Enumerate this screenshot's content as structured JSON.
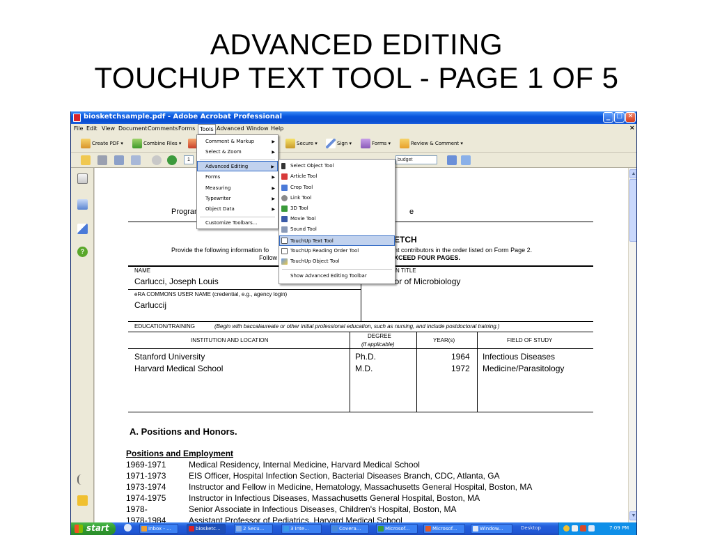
{
  "slide": {
    "title_line1": "ADVANCED EDITING",
    "title_line2": "TOUCHUP TEXT TOOL - PAGE 1 OF 5"
  },
  "window": {
    "title": "biosketchsample.pdf - Adobe Acrobat Professional",
    "minimize_glyph": "_",
    "maximize_glyph": "□",
    "close_glyph": "✕",
    "doc_close_glyph": "×"
  },
  "menubar": [
    "File",
    "Edit",
    "View",
    "Document",
    "Comments",
    "Forms",
    "Tools",
    "Advanced",
    "Window",
    "Help"
  ],
  "toolbar": {
    "create_pdf": "Create PDF ▾",
    "combine_files": "Combine Files ▾",
    "secure": "Secure ▾",
    "sign": "Sign ▾",
    "forms": "Forms ▾",
    "review_comment": "Review & Comment ▾",
    "page_number": "1",
    "zoom_value": "…",
    "zoom_value2": "budget"
  },
  "tools_menu": {
    "items": [
      "Comment & Markup",
      "Select & Zoom",
      "Advanced Editing",
      "Forms",
      "Measuring",
      "Typewriter",
      "Object Data",
      "Customize Toolbars..."
    ]
  },
  "advanced_editing_menu": {
    "items": [
      "Select Object Tool",
      "Article Tool",
      "Crop Tool",
      "Link Tool",
      "3D Tool",
      "Movie Tool",
      "Sound Tool",
      "TouchUp Text Tool",
      "TouchUp Reading Order Tool",
      "TouchUp Object Tool",
      "Show Advanced Editing Toolbar"
    ]
  },
  "document": {
    "program_left": "Program",
    "program_right": "e",
    "biosketch_fragment": "ETCH",
    "instruction_left": "Provide the following information fo",
    "instruction_right": "nt contributors in the order listed on Form Page 2.",
    "follow_left": "Follow th",
    "follow_right": "XCEED FOUR PAGES.",
    "name_label": "NAME",
    "name_value": "Carlucci, Joseph Louis",
    "position_title_label": "N TITLE",
    "position_title_value": "Professor of Microbiology",
    "era_label": "eRA COMMONS USER NAME (credential, e.g., agency login)",
    "era_value": "Carluccij",
    "education_label": "EDUCATION/TRAINING",
    "education_note": "(Begin with baccalaureate or other initial professional education, such as nursing, and include postdoctoral training.)",
    "col_institution": "INSTITUTION AND LOCATION",
    "col_degree": "DEGREE",
    "col_degree_note": "(if applicable)",
    "col_years": "YEAR(s)",
    "col_field": "FIELD OF STUDY",
    "education_rows": [
      {
        "institution": "Stanford University",
        "degree": "Ph.D.",
        "year": "1964",
        "field": "Infectious Diseases"
      },
      {
        "institution": "Harvard Medical School",
        "degree": "M.D.",
        "year": "1972",
        "field": "Medicine/Parasitology"
      }
    ],
    "section_a": "A.  Positions and Honors.",
    "positions_heading": "Positions and Employment",
    "positions": [
      {
        "years": "1969-1971",
        "text": "Medical Residency, Internal Medicine, Harvard Medical School"
      },
      {
        "years": "1971-1973",
        "text": "EIS Officer, Hospital Infection Section, Bacterial Diseases Branch, CDC, Atlanta, GA"
      },
      {
        "years": "1973-1974",
        "text": "Instructor and Fellow in Medicine, Hematology, Massachusetts General Hospital, Boston, MA"
      },
      {
        "years": "1974-1975",
        "text": "Instructor in Infectious Diseases, Massachusetts General Hospital, Boston, MA"
      },
      {
        "years": "1978-",
        "text": "Senior Associate in Infectious Diseases, Children's Hospital, Boston, MA"
      },
      {
        "years": "1978-1984",
        "text": "Assistant Professor of Pediatrics, Harvard Medical School"
      }
    ]
  },
  "taskbar": {
    "start": "start",
    "tasks": [
      "Inbox - ...",
      "biosketc...",
      "2 Secu...",
      "3 Inte...",
      "Covera...",
      "Microsof...",
      "Microsof...",
      "Window..."
    ],
    "desktop": "Desktop",
    "clock": "7:09 PM"
  },
  "icons": {
    "pages": "pages-icon",
    "bookmarks": "bookmarks-icon",
    "signatures": "signatures-icon",
    "help": "help-icon",
    "attachments": "paperclip-icon",
    "comments": "comments-icon"
  },
  "colors": {
    "titlebar": "#0854dc",
    "menu_highlight": "#c1d2ee",
    "taskbar": "#245edb",
    "start": "#2f9a2f"
  }
}
